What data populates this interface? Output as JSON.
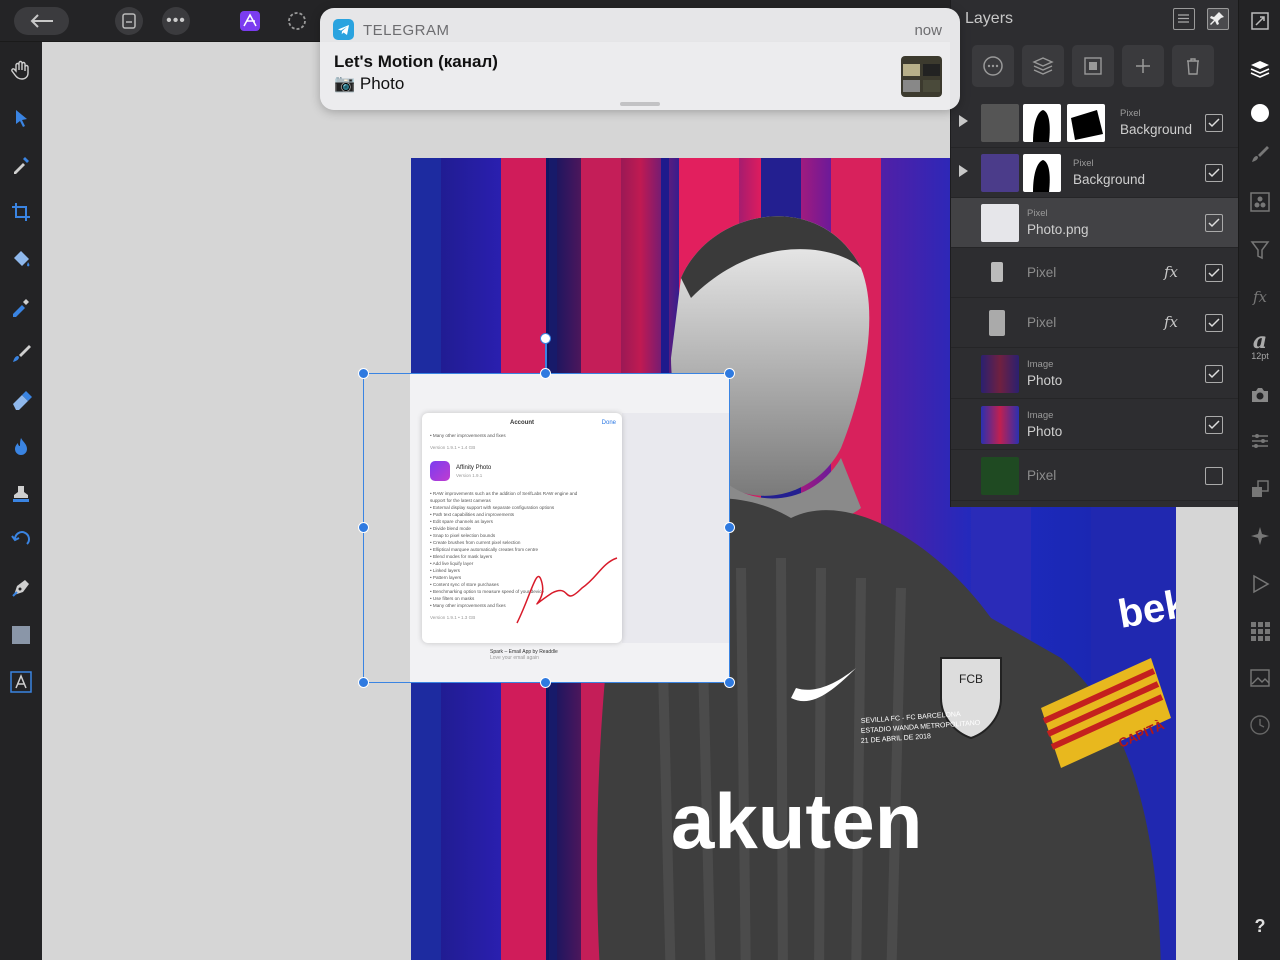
{
  "notification": {
    "app": "TELEGRAM",
    "time": "now",
    "title": "Let's Motion (канал)",
    "body": "📷 Photo"
  },
  "layers_panel": {
    "title": "Layers",
    "layers": [
      {
        "type": "Pixel",
        "name": "Background",
        "expandable": true,
        "checked": true,
        "fx": false,
        "dim": false
      },
      {
        "type": "Pixel",
        "name": "Background",
        "expandable": true,
        "checked": true,
        "fx": false,
        "dim": false
      },
      {
        "type": "Pixel",
        "name": "Photo.png",
        "expandable": false,
        "checked": true,
        "fx": false,
        "dim": false,
        "selected": true
      },
      {
        "type": "",
        "name": "Pixel",
        "expandable": false,
        "checked": true,
        "fx": true,
        "dim": true
      },
      {
        "type": "",
        "name": "Pixel",
        "expandable": false,
        "checked": true,
        "fx": true,
        "dim": true
      },
      {
        "type": "Image",
        "name": "Photo",
        "expandable": false,
        "checked": true,
        "fx": false,
        "dim": false
      },
      {
        "type": "Image",
        "name": "Photo",
        "expandable": false,
        "checked": true,
        "fx": false,
        "dim": false
      },
      {
        "type": "",
        "name": "Pixel",
        "expandable": false,
        "checked": false,
        "fx": false,
        "dim": true
      }
    ]
  },
  "right_toolbar": {
    "font_size": "12pt",
    "help": "?"
  },
  "pasted_screenshot": {
    "header": "Account",
    "done": "Done",
    "app_name": "Affinity Photo",
    "app_version": "Version 1.9.1",
    "lines": [
      "• Many other improvements and fixes",
      "Version 1.9.1 • 1.4 GB",
      "• RAW improvements such as the addition of SerifLabs RAW engine and",
      "support for the latest cameras",
      "• External display support with separate configuration options",
      "• Path text capabilities and improvements",
      "• Edit spare channels as layers",
      "• Divide blend mode",
      "• Snap to pixel selection bounds",
      "• Create brushes from current pixel selection",
      "• Elliptical marquee automatically creates from centre",
      "• Blend modes for mask layers",
      "• Add live liquify layer",
      "• Linked layers",
      "• Pattern layers",
      "• Content sync of store purchases",
      "• Benchmarking option to measure speed of your device",
      "• Use filters on masks",
      "• Many other improvements and fixes",
      "Version 1.9.1 • 1.3 GB"
    ],
    "bottom_app": "Spark – Email App by Readdle",
    "bottom_sub": "Love your email again"
  },
  "jersey": {
    "sponsor": "akuten",
    "sleeve": "beko",
    "captain": "CAPITÀ",
    "crest": "FCB",
    "match_line1": "SEVILLA FC - FC BARCELONA",
    "match_line2": "ESTADIO WANDA METROPOLITANO",
    "match_line3": "21 DE ABRIL DE 2018"
  },
  "colors": {
    "accent": "#3a84e2",
    "telegram": "#2aa3df",
    "panel": "#2d2d30"
  }
}
